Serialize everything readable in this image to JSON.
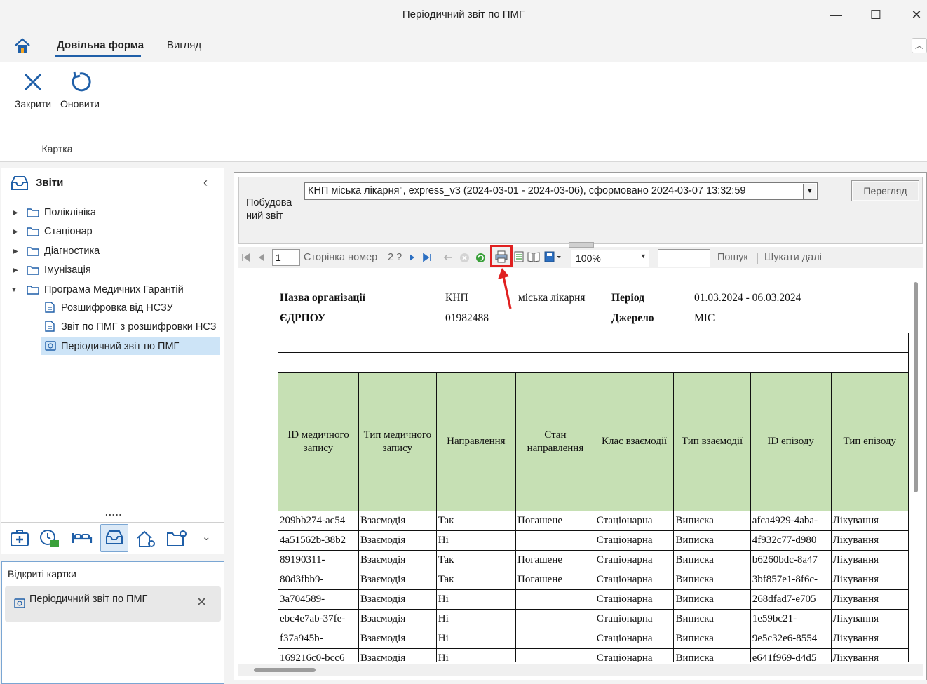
{
  "window": {
    "title": "Періодичний звіт по ПМГ",
    "minimize": "—",
    "maximize": "☐",
    "close": "✕"
  },
  "ribbon": {
    "tabs": [
      {
        "label": "Довільна форма",
        "active": true
      },
      {
        "label": "Вигляд",
        "active": false
      }
    ],
    "buttons": [
      {
        "label": "Закрити",
        "icon": "close-x-icon"
      },
      {
        "label": "Оновити",
        "icon": "refresh-icon"
      }
    ],
    "group_label": "Картка"
  },
  "nav": {
    "title": "Звіти",
    "items": [
      {
        "label": "Поліклініка",
        "type": "folder",
        "expanded": false
      },
      {
        "label": "Стаціонар",
        "type": "folder",
        "expanded": false
      },
      {
        "label": "Діагностика",
        "type": "folder",
        "expanded": false
      },
      {
        "label": "Імунізація",
        "type": "folder",
        "expanded": false
      },
      {
        "label": "Програма Медичних Гарантій",
        "type": "folder",
        "expanded": true
      },
      {
        "label": "Розшифровка від НСЗУ",
        "type": "report"
      },
      {
        "label": "Звіт по ПМГ з розшифровки НСЗ",
        "type": "report"
      },
      {
        "label": "Періодичний звіт по ПМГ",
        "type": "report",
        "selected": true
      }
    ],
    "splitter": "....."
  },
  "open_cards": {
    "title": "Відкриті картки",
    "items": [
      {
        "label": "Періодичний звіт по ПМГ"
      }
    ]
  },
  "report_header": {
    "build_label": "Побудова ний звіт",
    "selected_report": "КНП          міська лікарня\", express_v3 (2024-03-01 - 2024-03-06), сформовано 2024-03-07 13:32:59",
    "view_button": "Перегляд"
  },
  "viewer_toolbar": {
    "page_value": "1",
    "page_text": "Сторінка номер",
    "page_total": "2 ?",
    "zoom": "100%",
    "search_label": "Пошук",
    "search_next": "Шукати далі"
  },
  "report": {
    "org_label": "Назва організації",
    "org_value_1": "КНП",
    "org_value_2": "міська лікарня",
    "edrpou_label": "ЄДРПОУ",
    "edrpou_value": "01982488",
    "period_label": "Період",
    "period_value": "01.03.2024 - 06.03.2024",
    "source_label": "Джерело",
    "source_value": "МІС",
    "columns": [
      "ID медичного запису",
      "Тип медичного запису",
      "Направлення",
      "Стан направлення",
      "Клас взаємодії",
      "Тип взаємодії",
      "ID епізоду",
      "Тип епізоду"
    ],
    "rows": [
      [
        "209bb274-ac54",
        "Взаємодія",
        "Так",
        "Погашене",
        "Стаціонарна",
        "Виписка",
        "afca4929-4aba-",
        "Лікування"
      ],
      [
        "4a51562b-38b2",
        "Взаємодія",
        "Ні",
        "",
        "Стаціонарна",
        "Виписка",
        "4f932c77-d980",
        "Лікування"
      ],
      [
        "89190311-",
        "Взаємодія",
        "Так",
        "Погашене",
        "Стаціонарна",
        "Виписка",
        "b6260bdc-8a47",
        "Лікування"
      ],
      [
        "80d3fbb9-",
        "Взаємодія",
        "Так",
        "Погашене",
        "Стаціонарна",
        "Виписка",
        "3bf857e1-8f6c-",
        "Лікування"
      ],
      [
        "3a704589-",
        "Взаємодія",
        "Ні",
        "",
        "Стаціонарна",
        "Виписка",
        "268dfad7-e705",
        "Лікування"
      ],
      [
        "ebc4e7ab-37fe-",
        "Взаємодія",
        "Ні",
        "",
        "Стаціонарна",
        "Виписка",
        "1e59bc21-",
        "Лікування"
      ],
      [
        "f37a945b-",
        "Взаємодія",
        "Ні",
        "",
        "Стаціонарна",
        "Виписка",
        "9e5c32e6-8554",
        "Лікування"
      ],
      [
        "169216c0-bcc6",
        "Взаємодія",
        "Ні",
        "",
        "Стаціонарна",
        "Виписка",
        "e641f969-d4d5",
        "Лікування"
      ]
    ]
  },
  "colors": {
    "accent": "#1f5fa8",
    "header_green": "#c6e0b4",
    "highlight_red": "#e02020",
    "selected": "#cde4f7"
  }
}
